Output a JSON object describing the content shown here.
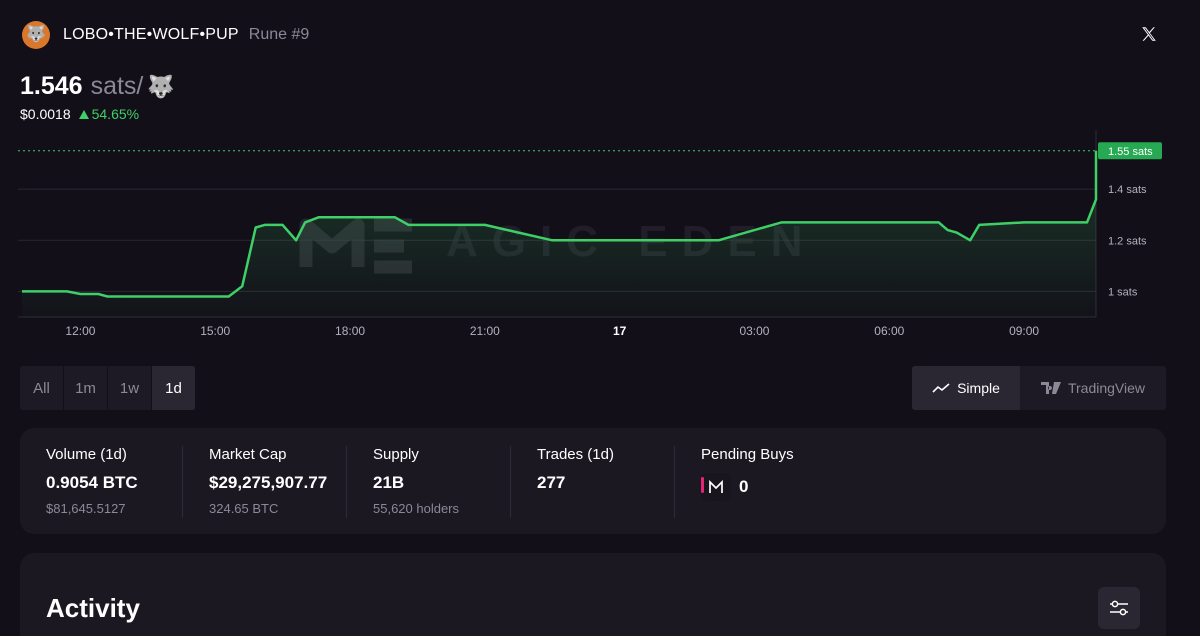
{
  "header": {
    "rune_name": "LOBO•THE•WOLF•PUP",
    "rune_number": "Rune #9",
    "logo_icon": "wolf-pup-avatar",
    "close_icon": "x-icon"
  },
  "price": {
    "value": "1.546",
    "unit": "sats/",
    "unit_icon": "🐺",
    "usd": "$0.0018",
    "change": "54.65%",
    "change_direction": "up",
    "change_color": "#3ecf67"
  },
  "chart_data": {
    "type": "line",
    "watermark": "MAGIC EDEN",
    "x_tick_labels": [
      "12:00",
      "15:00",
      "18:00",
      "21:00",
      "17",
      "03:00",
      "06:00",
      "09:00"
    ],
    "y_tick_labels": [
      "1 sats",
      "1.2 sats",
      "1.4 sats"
    ],
    "y_ticks": [
      1.0,
      1.2,
      1.4
    ],
    "ylim": [
      0.9,
      1.6
    ],
    "x_range_hours": [
      10.7,
      34.6
    ],
    "last_price_label": "1.55 sats",
    "last_price": 1.55,
    "line_color": "#3ecf67",
    "series": [
      {
        "x": [
          10.7,
          11.7,
          12.0,
          12.4,
          12.6,
          12.8,
          13.4,
          14.6,
          15.3,
          15.6,
          15.9,
          16.1,
          16.5,
          16.8,
          17.0,
          17.3,
          17.7,
          18.4,
          19.0,
          19.3,
          20.3,
          21.0,
          22.5,
          23.2,
          23.6,
          24.0,
          24.6,
          25.2,
          26.2,
          27.6,
          28.8,
          29.6,
          30.2,
          30.6,
          30.9,
          31.1,
          31.3,
          31.5,
          31.8,
          32.0,
          33.0,
          34.1,
          34.4,
          34.6
        ],
        "y": [
          1.0,
          1.0,
          0.99,
          0.99,
          0.98,
          0.98,
          0.98,
          0.98,
          0.98,
          1.02,
          1.25,
          1.26,
          1.26,
          1.2,
          1.27,
          1.29,
          1.29,
          1.29,
          1.29,
          1.26,
          1.26,
          1.26,
          1.2,
          1.2,
          1.2,
          1.2,
          1.2,
          1.2,
          1.2,
          1.27,
          1.27,
          1.27,
          1.27,
          1.27,
          1.27,
          1.27,
          1.24,
          1.23,
          1.2,
          1.26,
          1.27,
          1.27,
          1.27,
          1.36
        ]
      }
    ]
  },
  "ranges": {
    "items": [
      "All",
      "1m",
      "1w",
      "1d"
    ],
    "active": "1d"
  },
  "views": {
    "simple_label": "Simple",
    "tradingview_label": "TradingView",
    "active": "Simple"
  },
  "stats": {
    "volume_label": "Volume (1d)",
    "volume_value": "0.9054 BTC",
    "volume_usd": "$81,645.5127",
    "mcap_label": "Market Cap",
    "mcap_value": "$29,275,907.77",
    "mcap_btc": "324.65 BTC",
    "supply_label": "Supply",
    "supply_value": "21B",
    "supply_holders": "55,620 holders",
    "trades_label": "Trades (1d)",
    "trades_value": "277",
    "pending_label": "Pending Buys",
    "pending_value": "0"
  },
  "activity": {
    "title": "Activity"
  }
}
